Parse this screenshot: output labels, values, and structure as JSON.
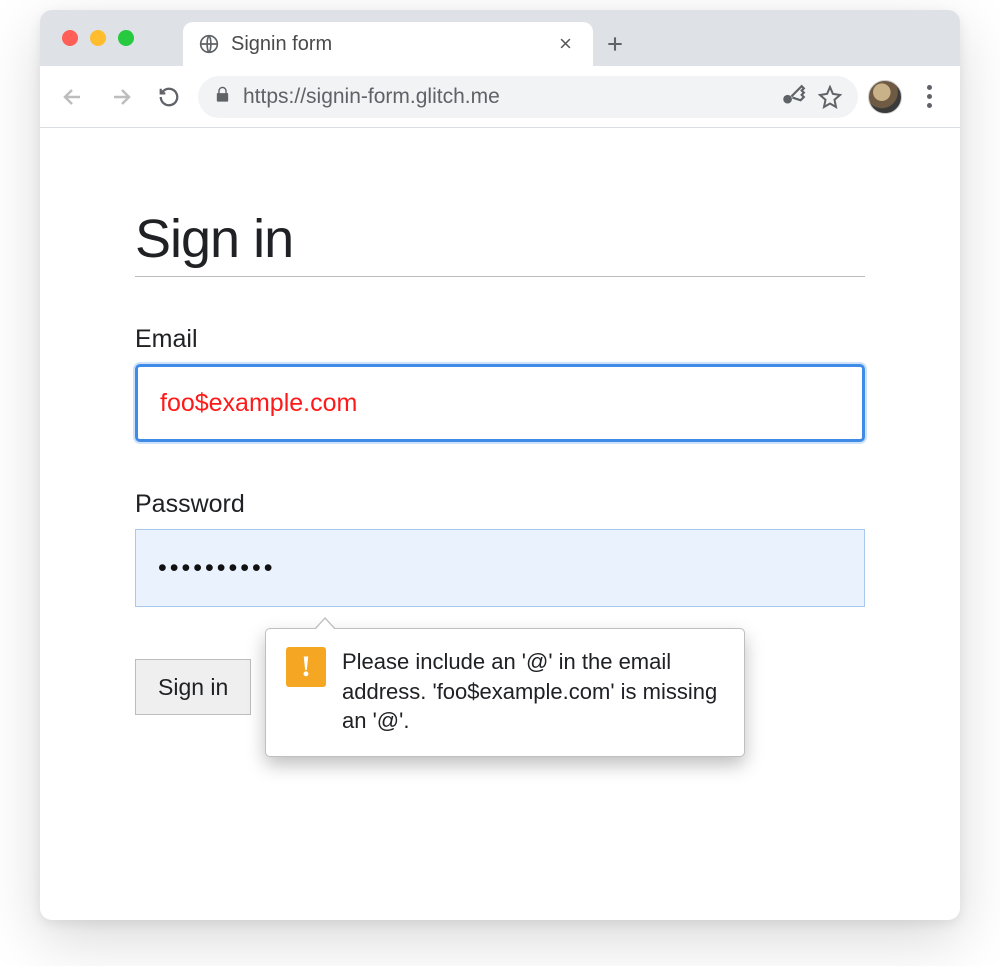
{
  "browser": {
    "tab_title": "Signin form",
    "url": "https://signin-form.glitch.me"
  },
  "page": {
    "heading": "Sign in",
    "email_label": "Email",
    "email_value": "foo$example.com",
    "password_label": "Password",
    "password_value": "••••••••••",
    "submit_label": "Sign in"
  },
  "validation": {
    "message": "Please include an '@' in the email address. 'foo$example.com' is missing an '@'."
  }
}
